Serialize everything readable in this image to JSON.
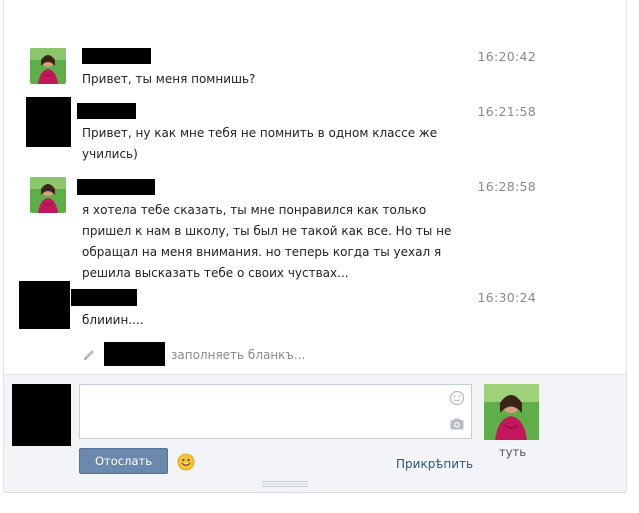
{
  "messages": [
    {
      "time": "16:20:42",
      "lines": [
        "Привет, ты меня помнишь?"
      ],
      "avatar": "photo"
    },
    {
      "time": "16:21:58",
      "lines": [
        "Привет, ну как мне тебя не помнить в одном классе же",
        "учились)"
      ],
      "avatar": "redacted"
    },
    {
      "time": "16:28:58",
      "lines": [
        "я хотела тебе сказать, ты мне понравился как только",
        "пришел к нам в школу, ты был не такой как все. Но ты не",
        "обращал на меня внимания. но теперь когда ты уехал я",
        "решила высказать тебе о своих чуствах..."
      ],
      "avatar": "photo"
    },
    {
      "time": "16:30:24",
      "lines": [
        "блииин...."
      ],
      "avatar": "redacted"
    }
  ],
  "typing": {
    "text": "заполняеть бланкъ..."
  },
  "compose": {
    "send_label": "Отослать",
    "attach_label": "Прикрѣпить",
    "recipient_name": "туть"
  },
  "icons": {
    "pencil": "pencil-icon",
    "smile": "smile-icon",
    "camera": "camera-icon",
    "emoji": "emoji-icon"
  },
  "colors": {
    "send_button": "#6b89ad",
    "time": "#8a8a8a",
    "link": "#2b587a"
  }
}
